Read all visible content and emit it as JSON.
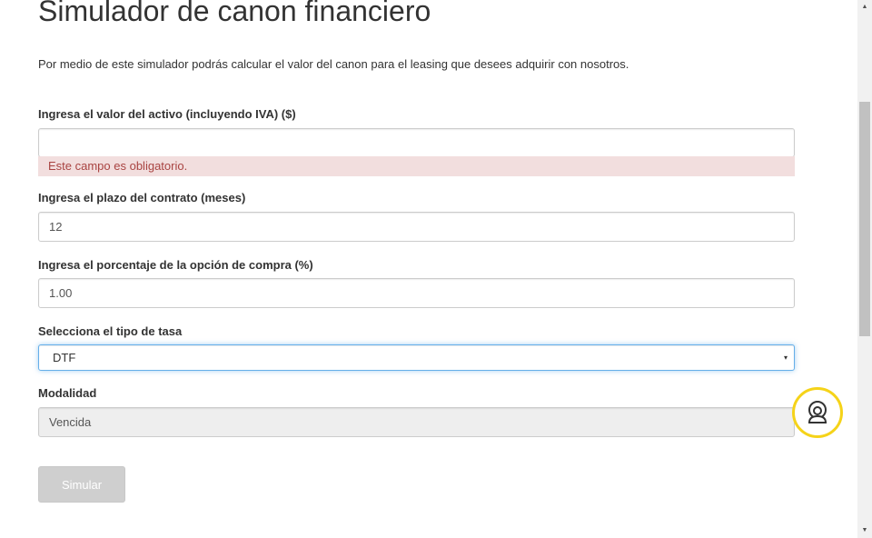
{
  "page": {
    "title": "Simulador de canon financiero",
    "intro": "Por medio de este simulador podrás calcular el valor del canon para el leasing que desees adquirir con nosotros."
  },
  "form": {
    "asset_value": {
      "label": "Ingresa el valor del activo (incluyendo IVA) ($)",
      "value": "",
      "error": "Este campo es obligatorio."
    },
    "term": {
      "label": "Ingresa el plazo del contrato (meses)",
      "value": "12"
    },
    "purchase_option": {
      "label": "Ingresa el porcentaje de la opción de compra (%)",
      "value": "1.00"
    },
    "rate_type": {
      "label": "Selecciona el tipo de tasa",
      "selected": "DTF"
    },
    "modality": {
      "label": "Modalidad",
      "value": "Vencida"
    },
    "submit_label": "Simular"
  },
  "icons": {
    "chat": "chat-agent-icon",
    "select_arrow": "▾",
    "scroll_up": "▲",
    "scroll_down": "▼"
  },
  "colors": {
    "error_bg": "#f2dede",
    "error_text": "#a94442",
    "focus_border": "#66afe9",
    "chat_ring": "#f5d319",
    "button_disabled": "#cfcfcf"
  }
}
